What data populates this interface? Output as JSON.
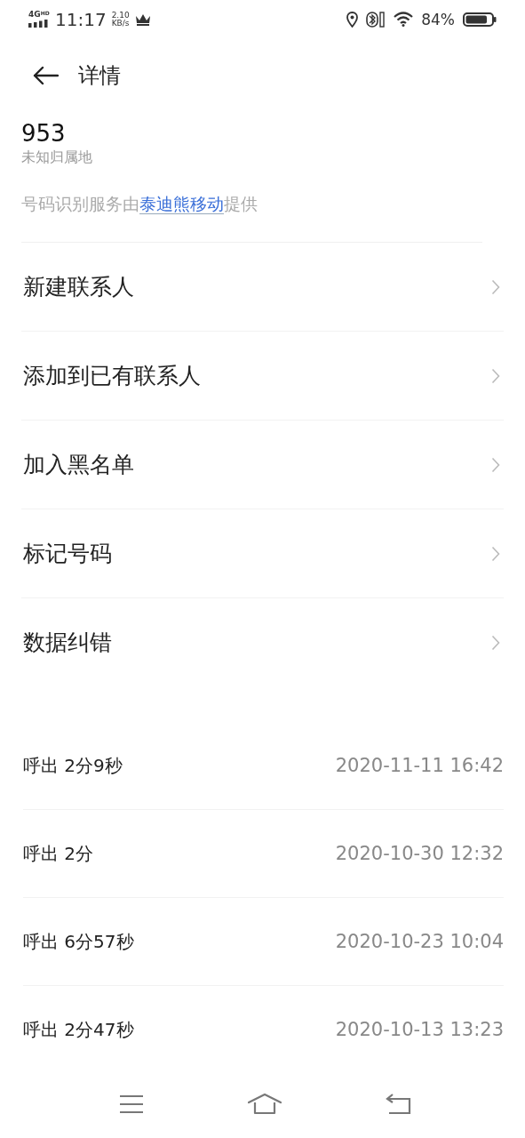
{
  "status_bar": {
    "network": "4G",
    "network_sup": "HD",
    "time": "11:17",
    "speed_value": "2.10",
    "speed_unit": "KB/s",
    "battery": "84%"
  },
  "header": {
    "title": "详情"
  },
  "caller": {
    "number": "953",
    "location": "未知归属地",
    "provider_prefix": "号码识别服务由",
    "provider_link": "泰迪熊移动",
    "provider_suffix": "提供"
  },
  "actions": [
    {
      "label": "新建联系人"
    },
    {
      "label": "添加到已有联系人"
    },
    {
      "label": "加入黑名单"
    },
    {
      "label": "标记号码"
    },
    {
      "label": "数据纠错"
    }
  ],
  "call_log": [
    {
      "type": "呼出",
      "duration": "2分9秒",
      "time": "2020-11-11 16:42"
    },
    {
      "type": "呼出",
      "duration": "2分",
      "time": "2020-10-30 12:32"
    },
    {
      "type": "呼出",
      "duration": "6分57秒",
      "time": "2020-10-23 10:04"
    },
    {
      "type": "呼出",
      "duration": "2分47秒",
      "time": "2020-10-13 13:23"
    }
  ],
  "nav_bar": {
    "buttons": [
      {
        "kind": "menu"
      },
      {
        "kind": "home"
      },
      {
        "kind": "back"
      }
    ]
  }
}
